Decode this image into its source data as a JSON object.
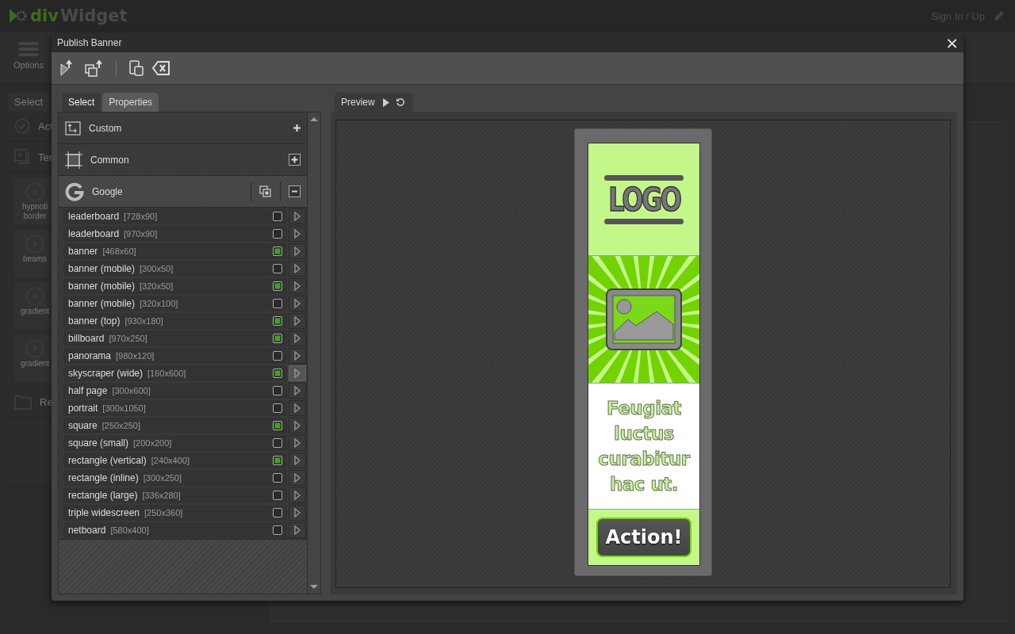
{
  "app": {
    "logo": {
      "prefix": "div",
      "suffix": "Widget"
    },
    "sign_in": "Sign In / Up",
    "options_label": "Options",
    "side_tab": "Select",
    "side_items": [
      {
        "label": "Act"
      },
      {
        "label": "Ter"
      }
    ],
    "tiles": [
      {
        "lines": [
          "hypnoti",
          "border"
        ]
      },
      {
        "lines": [
          "beams"
        ]
      },
      {
        "lines": [
          "gradient"
        ]
      },
      {
        "lines": [
          "gradient"
        ]
      }
    ],
    "side_footer": "Re"
  },
  "dialog": {
    "title": "Publish Banner",
    "close": "×",
    "tabs": [
      {
        "label": "Select",
        "selected": true
      },
      {
        "label": "Properties",
        "selected": false
      }
    ],
    "groups": [
      {
        "kind": "custom",
        "label": "Custom",
        "expanded": false
      },
      {
        "kind": "common",
        "label": "Common",
        "expanded": false
      },
      {
        "kind": "google",
        "label": "Google",
        "expanded": true,
        "items": [
          {
            "label": "leaderboard",
            "size": "[728x90]",
            "checked": false,
            "selected": false
          },
          {
            "label": "leaderboard",
            "size": "[970x90]",
            "checked": false,
            "selected": false
          },
          {
            "label": "banner",
            "size": "[468x60]",
            "checked": true,
            "selected": false
          },
          {
            "label": "banner (mobile)",
            "size": "[300x50]",
            "checked": false,
            "selected": false
          },
          {
            "label": "banner (mobile)",
            "size": "[320x50]",
            "checked": true,
            "selected": false
          },
          {
            "label": "banner (mobile)",
            "size": "[320x100]",
            "checked": false,
            "selected": false
          },
          {
            "label": "banner (top)",
            "size": "[930x180]",
            "checked": true,
            "selected": false
          },
          {
            "label": "billboard",
            "size": "[970x250]",
            "checked": true,
            "selected": false
          },
          {
            "label": "panorama",
            "size": "[980x120]",
            "checked": false,
            "selected": false
          },
          {
            "label": "skyscraper (wide)",
            "size": "[160x600]",
            "checked": true,
            "selected": true
          },
          {
            "label": "half page",
            "size": "[300x600]",
            "checked": false,
            "selected": false
          },
          {
            "label": "portrait",
            "size": "[300x1050]",
            "checked": false,
            "selected": false
          },
          {
            "label": "square",
            "size": "[250x250]",
            "checked": true,
            "selected": false
          },
          {
            "label": "square (small)",
            "size": "[200x200]",
            "checked": false,
            "selected": false
          },
          {
            "label": "rectangle (vertical)",
            "size": "[240x400]",
            "checked": true,
            "selected": false
          },
          {
            "label": "rectangle (inline)",
            "size": "[300x250]",
            "checked": false,
            "selected": false
          },
          {
            "label": "rectangle (large)",
            "size": "[336x280]",
            "checked": false,
            "selected": false
          },
          {
            "label": "triple widescreen",
            "size": "[250x360]",
            "checked": false,
            "selected": false
          },
          {
            "label": "netboard",
            "size": "[580x400]",
            "checked": false,
            "selected": false
          }
        ]
      }
    ],
    "preview": {
      "tab": "Preview",
      "banner": {
        "logo": "LOGO",
        "text": "Feugiat luctus curabitur hac ut.",
        "button": "Action!"
      }
    }
  }
}
